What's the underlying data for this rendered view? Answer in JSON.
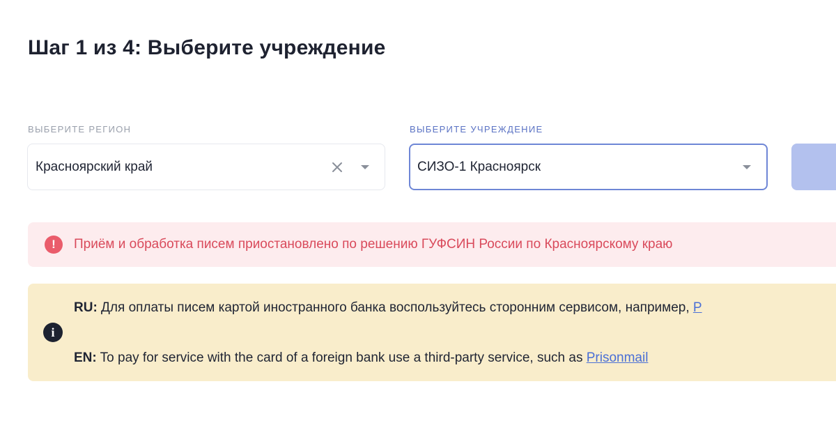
{
  "header": {
    "title": "Шаг 1 из 4: Выберите учреждение"
  },
  "region": {
    "label": "ВЫБЕРИТЕ РЕГИОН",
    "value": "Красноярский край"
  },
  "institution": {
    "label": "ВЫБЕРИТЕ УЧРЕЖДЕНИЕ",
    "value": "СИЗО-1 Красноярск"
  },
  "alert_error": {
    "icon": "exclamation-icon",
    "text": "Приём и обработка писем приостановлено по решению ГУФСИН России по Красноярскому краю"
  },
  "alert_info": {
    "icon": "info-icon",
    "ru_prefix": "RU:",
    "ru_text": " Для оплаты писем картой иностранного банка воспользуйтесь сторонним сервисом, например, ",
    "ru_link": "P",
    "en_prefix": "EN:",
    "en_text": " To pay for service with the card of a foreign bank use a third-party service, such as ",
    "en_link": "Prisonmail"
  },
  "colors": {
    "accent": "#6e86d6",
    "button": "#b3c1ee",
    "error_bg": "#fdecee",
    "error_text": "#d94a5b",
    "info_bg": "#f9edcb"
  }
}
